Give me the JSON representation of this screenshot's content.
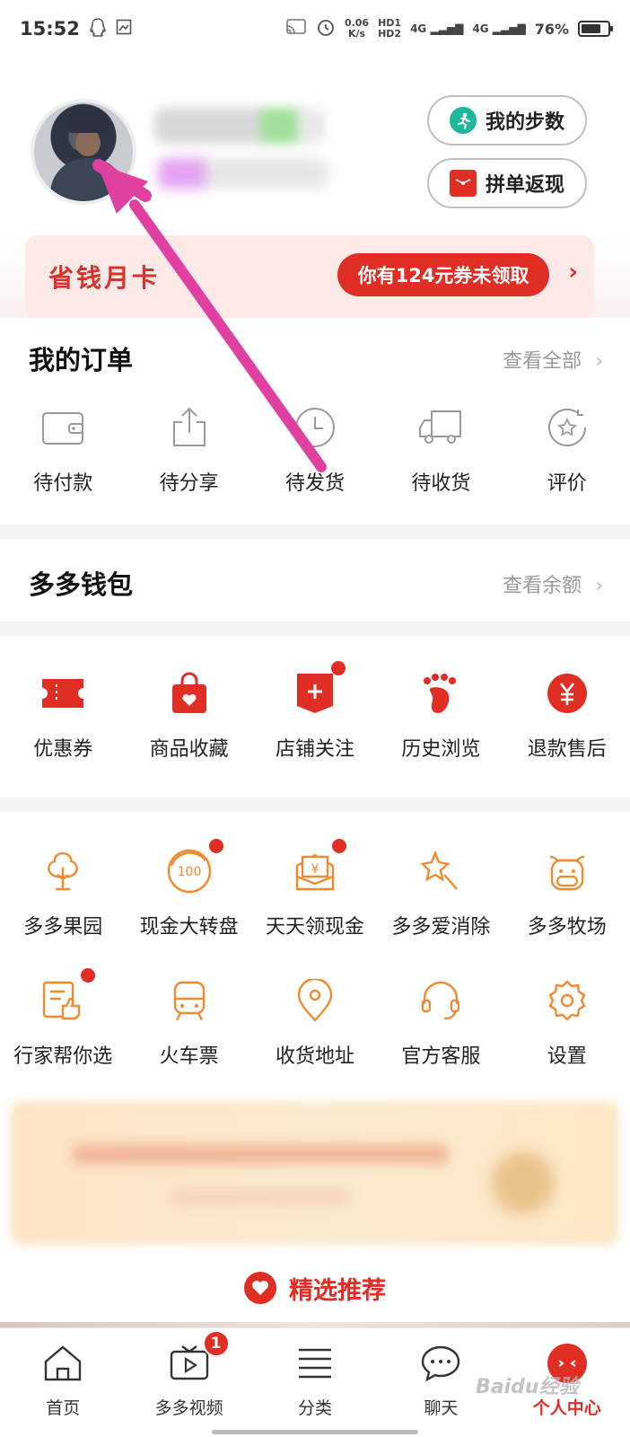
{
  "status_bar": {
    "time": "15:52",
    "net_speed_value": "0.06",
    "net_speed_unit": "K/s",
    "hd1": "HD1",
    "hd2": "HD2",
    "signal1": "4G",
    "signal2": "4G",
    "battery_percent": "76%"
  },
  "profile": {
    "steps_button": "我的步数",
    "groupbuy_button": "拼单返现"
  },
  "monthly_card": {
    "title": "省钱月卡",
    "coupon_text": "你有124元券未领取",
    "arrow": "›"
  },
  "orders": {
    "title": "我的订单",
    "view_all": "查看全部",
    "items": [
      {
        "label": "待付款",
        "icon": "wallet-icon"
      },
      {
        "label": "待分享",
        "icon": "share-icon"
      },
      {
        "label": "待发货",
        "icon": "clock-icon"
      },
      {
        "label": "待收货",
        "icon": "truck-icon"
      },
      {
        "label": "评价",
        "icon": "star-review-icon"
      }
    ]
  },
  "wallet": {
    "title": "多多钱包",
    "view_balance": "查看余额"
  },
  "services": {
    "items": [
      {
        "label": "优惠券",
        "icon": "coupon-icon"
      },
      {
        "label": "商品收藏",
        "icon": "favorite-bag-icon"
      },
      {
        "label": "店铺关注",
        "icon": "store-follow-icon"
      },
      {
        "label": "历史浏览",
        "icon": "footprint-icon"
      },
      {
        "label": "退款售后",
        "icon": "refund-icon"
      }
    ]
  },
  "tools": {
    "row1": [
      {
        "label": "多多果园",
        "icon": "tree-icon"
      },
      {
        "label": "现金大转盘",
        "icon": "wheel-icon",
        "icon_text": "100"
      },
      {
        "label": "天天领现金",
        "icon": "cash-envelope-icon",
        "icon_text": "¥"
      },
      {
        "label": "多多爱消除",
        "icon": "magic-star-icon"
      },
      {
        "label": "多多牧场",
        "icon": "cow-icon"
      }
    ],
    "row2": [
      {
        "label": "行家帮你选",
        "icon": "recommend-icon"
      },
      {
        "label": "火车票",
        "icon": "train-icon"
      },
      {
        "label": "收货地址",
        "icon": "location-icon"
      },
      {
        "label": "官方客服",
        "icon": "headset-icon"
      },
      {
        "label": "设置",
        "icon": "settings-gear-icon"
      }
    ]
  },
  "featured": {
    "title": "精选推荐"
  },
  "tabbar": {
    "tabs": [
      {
        "label": "首页",
        "icon": "home-icon"
      },
      {
        "label": "多多视频",
        "icon": "video-icon",
        "badge": "1"
      },
      {
        "label": "分类",
        "icon": "category-list-icon"
      },
      {
        "label": "聊天",
        "icon": "chat-icon"
      },
      {
        "label": "个人中心",
        "icon": "profile-face-icon",
        "active": true
      }
    ]
  },
  "watermark": "Baidu经验",
  "colors": {
    "brand_red": "#e02e24",
    "accent_orange": "#f08a2e",
    "steps_green": "#1cb79c",
    "annotation_arrow": "#e040a0"
  }
}
